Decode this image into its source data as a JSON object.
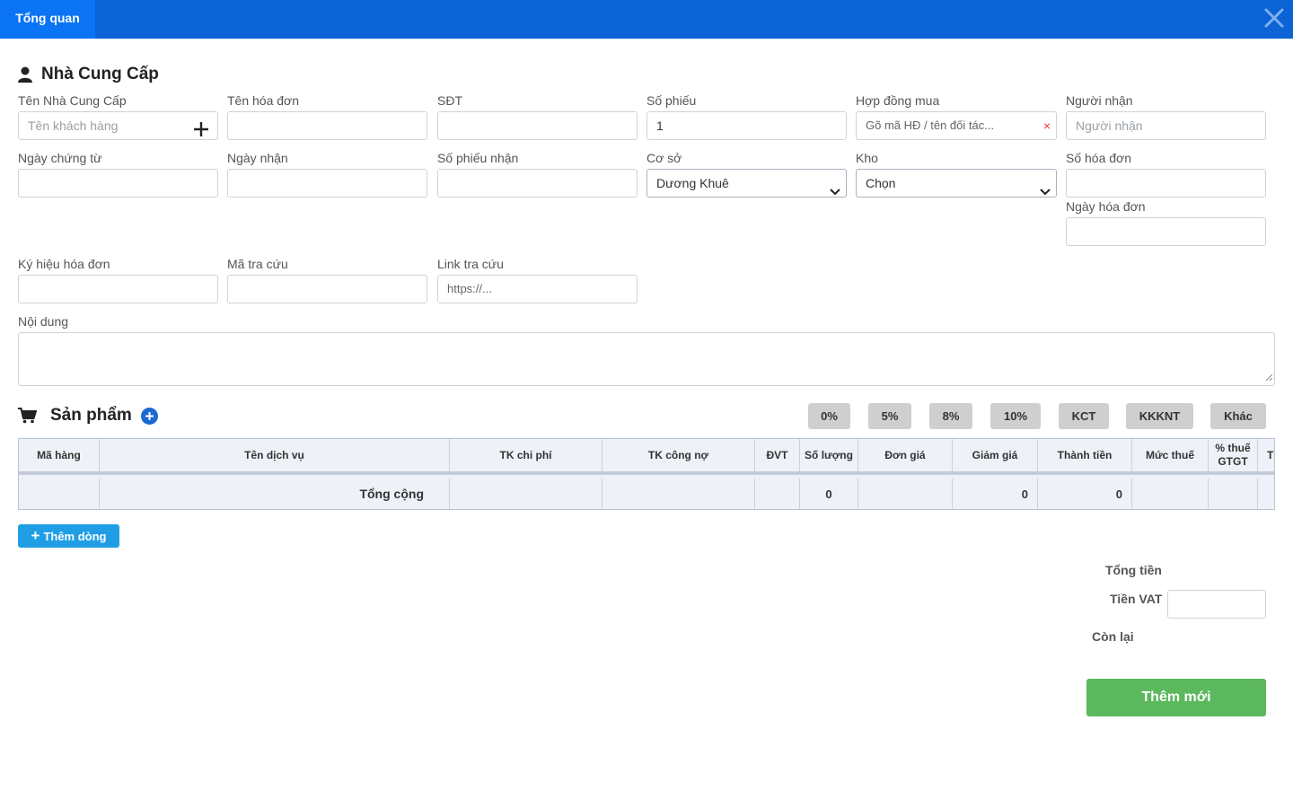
{
  "header": {
    "tab_label": "Tổng quan"
  },
  "supplier_section": {
    "title": "Nhà Cung Cấp"
  },
  "fields": {
    "supplier_name": {
      "label": "Tên Nhà Cung Cấp",
      "placeholder": "Tên khách hàng"
    },
    "invoice_name": {
      "label": "Tên hóa đơn",
      "value": ""
    },
    "phone": {
      "label": "SĐT",
      "value": ""
    },
    "voucher_no": {
      "label": "Số phiếu",
      "value": "1"
    },
    "purchase_contract": {
      "label": "Hợp đồng mua",
      "placeholder": "Gõ mã HĐ / tên đối tác..."
    },
    "receiver": {
      "label": "Người nhận",
      "placeholder": "Người nhận"
    },
    "doc_date": {
      "label": "Ngày chứng từ",
      "value": ""
    },
    "receive_date": {
      "label": "Ngày nhận",
      "value": ""
    },
    "receipt_no": {
      "label": "Số phiếu nhận",
      "value": ""
    },
    "branch": {
      "label": "Cơ sở",
      "selected": "Dương Khuê"
    },
    "warehouse": {
      "label": "Kho",
      "selected": "Chọn"
    },
    "invoice_no": {
      "label": "Số hóa đơn",
      "value": ""
    },
    "invoice_date": {
      "label": "Ngày hóa đơn",
      "value": ""
    },
    "invoice_symbol": {
      "label": "Ký hiệu hóa đơn",
      "value": ""
    },
    "lookup_code": {
      "label": "Mã tra cứu",
      "value": ""
    },
    "lookup_link": {
      "label": "Link tra cứu",
      "placeholder": "https://..."
    },
    "content": {
      "label": "Nội dung",
      "value": ""
    }
  },
  "products_section": {
    "title": "Sản phẩm"
  },
  "tax_buttons": [
    "0%",
    "5%",
    "8%",
    "10%",
    "KCT",
    "KKKNT",
    "Khác"
  ],
  "table": {
    "headers": [
      "Mã hàng",
      "Tên dịch vụ",
      "TK chi phí",
      "TK công nợ",
      "ĐVT",
      "Số lượng",
      "Đơn giá",
      "Giảm giá",
      "Thành tiền",
      "Mức thuế",
      "% thuế GTGT",
      "Ti"
    ],
    "total_row": {
      "label": "Tổng cộng",
      "quantity": "0",
      "discount": "0",
      "amount": "0"
    }
  },
  "add_row_label": "Thêm dòng",
  "summary": {
    "total_label": "Tổng tiền",
    "vat_label": "Tiền VAT",
    "vat_value": "",
    "remaining_label": "Còn lại"
  },
  "submit_label": "Thêm mới",
  "colors": {
    "header_bar": "#0b63d6",
    "active_tab": "#0a74f5",
    "submit": "#5cb85c",
    "add_row": "#1f9ee6"
  }
}
